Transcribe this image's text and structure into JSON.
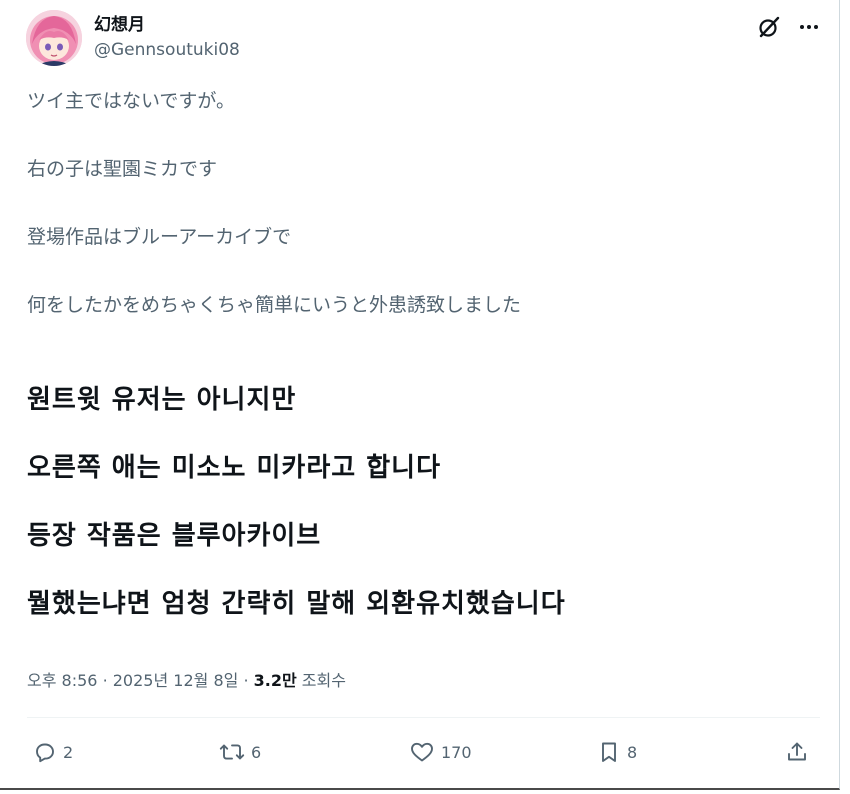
{
  "author": {
    "display_name": "幻想月",
    "handle": "@Gennsoutuki08"
  },
  "icons": {
    "grok": "grok-icon",
    "more": "more-icon",
    "reply": "reply-icon",
    "repost": "repost-icon",
    "like": "heart-icon",
    "bookmark": "bookmark-icon",
    "share": "share-icon"
  },
  "post": {
    "jp_lines": [
      "ツイ主ではないですが。",
      "右の子は聖園ミカです",
      "登場作品はブルーアーカイブで",
      "何をしたかをめちゃくちゃ簡単にいうと外患誘致しました"
    ],
    "ko_lines": [
      "원트윗 유저는 아니지만",
      "오른쪽 애는 미소노 미카라고 합니다",
      "등장 작품은 블루아카이브",
      "뭘했는냐면 엄청 간략히 말해 외환유치했습니다"
    ]
  },
  "meta": {
    "time": "오후 8:56",
    "separator": "·",
    "date": "2025년 12월 8일",
    "views_count": "3.2만",
    "views_label": "조회수"
  },
  "stats": {
    "replies": "2",
    "reposts": "6",
    "likes": "170",
    "bookmarks": "8"
  },
  "colors": {
    "text_primary": "#0f1419",
    "text_secondary": "#536471",
    "divider": "#eff3f4"
  }
}
